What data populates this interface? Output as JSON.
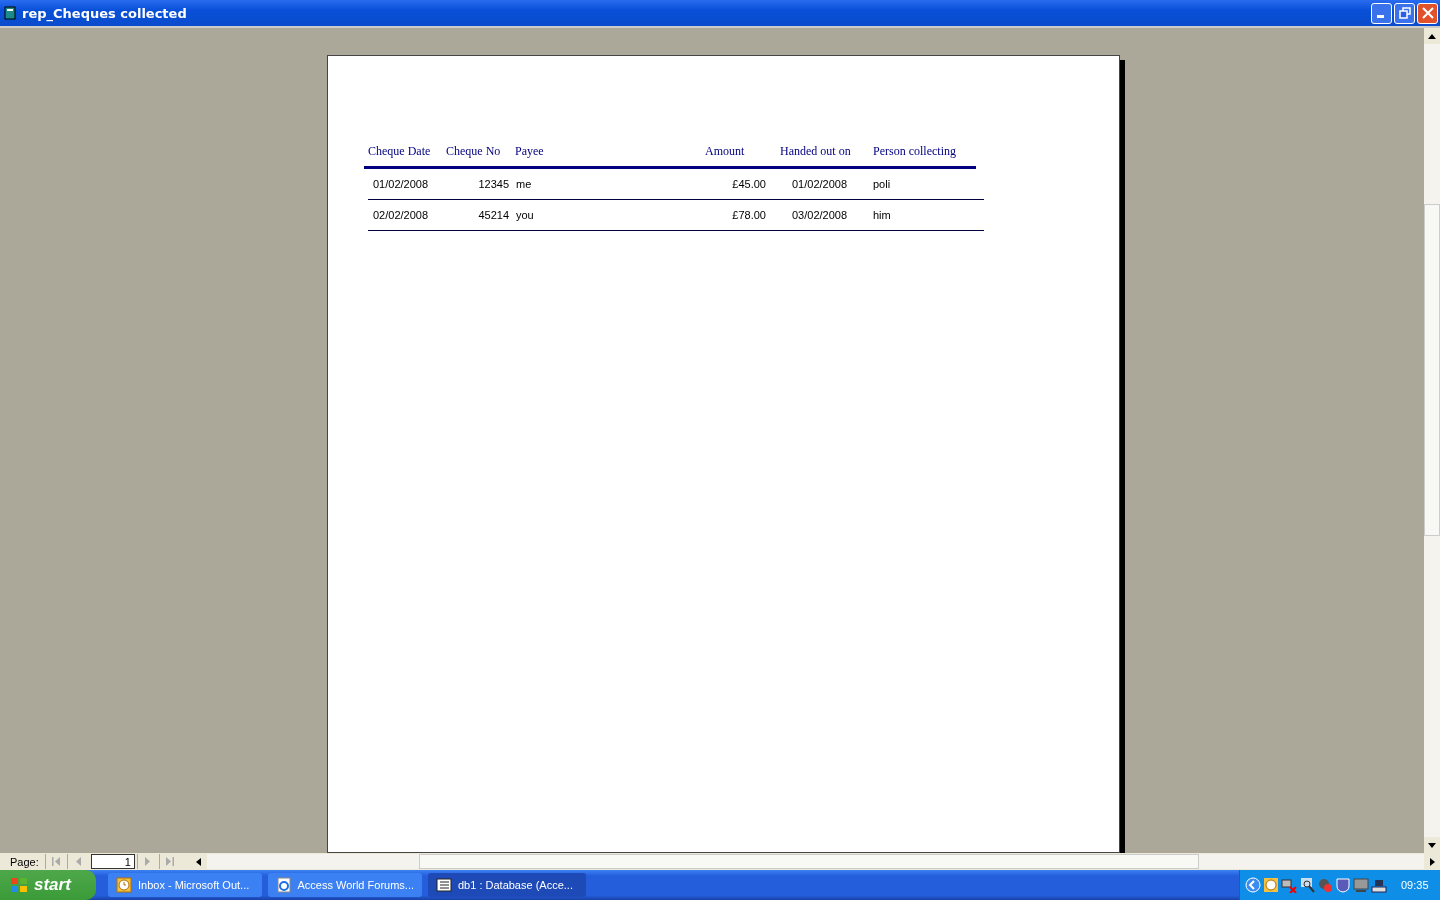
{
  "window": {
    "title": "rep_Cheques collected"
  },
  "report": {
    "columns": [
      "Cheque Date",
      "Cheque No",
      "Payee",
      "Amount",
      "Handed out on",
      "Person collecting"
    ],
    "rows": [
      [
        "01/02/2008",
        "12345",
        "me",
        "£45.00",
        "01/02/2008",
        "poli"
      ],
      [
        "02/02/2008",
        "45214",
        "you",
        "£78.00",
        "03/02/2008",
        "him"
      ]
    ]
  },
  "navigation": {
    "label": "Page:",
    "page": "1"
  },
  "taskbar": {
    "start": "start",
    "tasks": [
      {
        "label": "Inbox - Microsoft Out...",
        "kind": "clock",
        "selected": false
      },
      {
        "label": "Access World Forums...",
        "kind": "browser",
        "selected": false
      },
      {
        "label": "db1 : Database (Acce...",
        "kind": "database",
        "selected": true
      }
    ],
    "clock": "09:35"
  }
}
